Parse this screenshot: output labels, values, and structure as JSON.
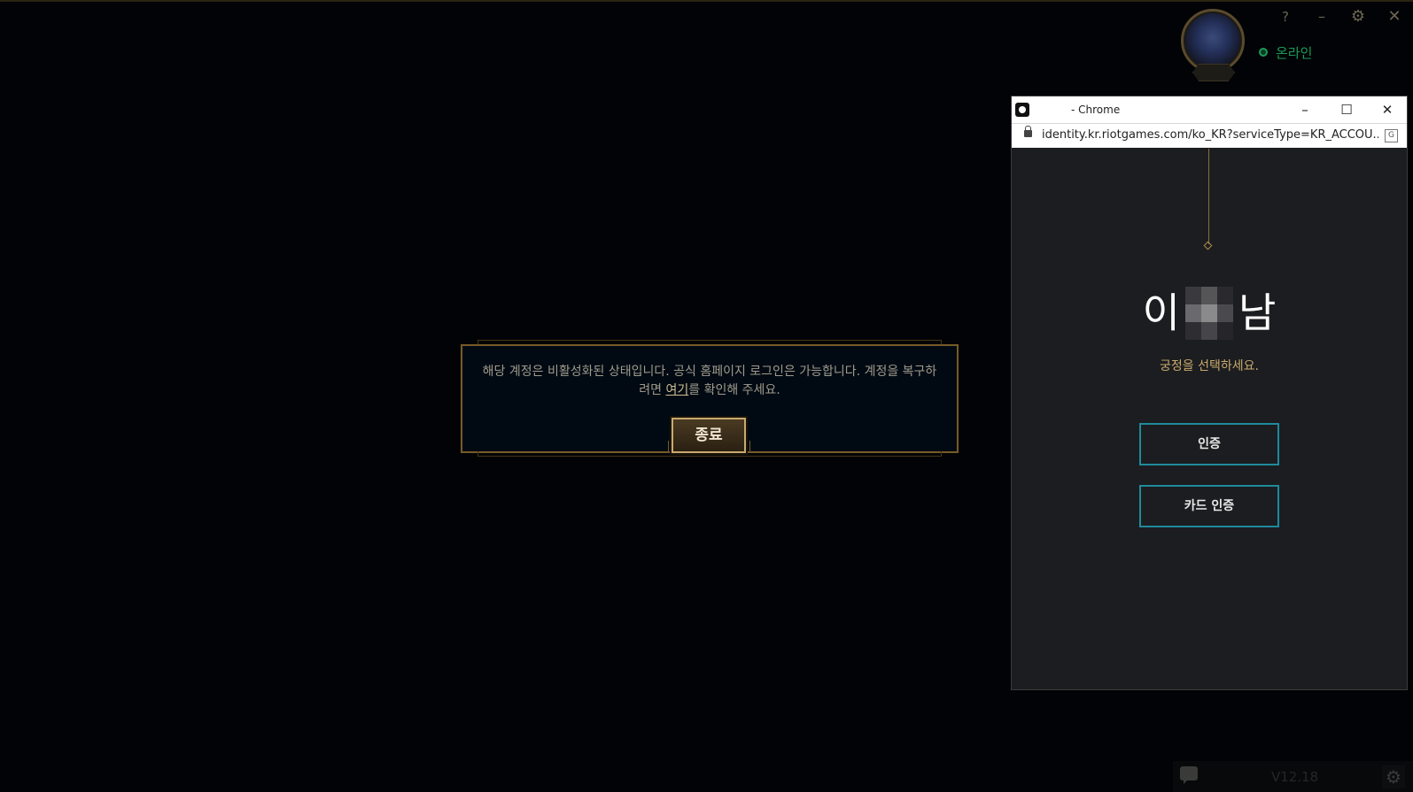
{
  "client": {
    "help_label": "?",
    "minimize_label": "–",
    "settings_label": "⚙",
    "close_label": "✕",
    "status": "온라인",
    "version": "V12.18"
  },
  "modal": {
    "message_part1": "해당 계정은 비활성화된 상태입니다. 공식 홈페이지 로그인은 가능합니다. 계정을 복구하려면 ",
    "link_text": "여기",
    "message_part2": "를 확인해 주세요.",
    "close_button": "종료"
  },
  "chrome": {
    "title": "- Chrome",
    "url": "identity.kr.riotgames.com/ko_KR?serviceType=KR_ACCOU...",
    "min_label": "–",
    "max_label": "☐",
    "close_label": "✕",
    "translate_label": "G"
  },
  "identity_page": {
    "name_first": "이",
    "name_last": "남",
    "prompt": "궁정을 선택하세요.",
    "buttons": [
      "인증",
      "카드 인증"
    ]
  },
  "colors": {
    "accent_gold": "#c8aa6e",
    "accent_teal": "#1e8a9c",
    "status_green": "#1b9a5a"
  }
}
